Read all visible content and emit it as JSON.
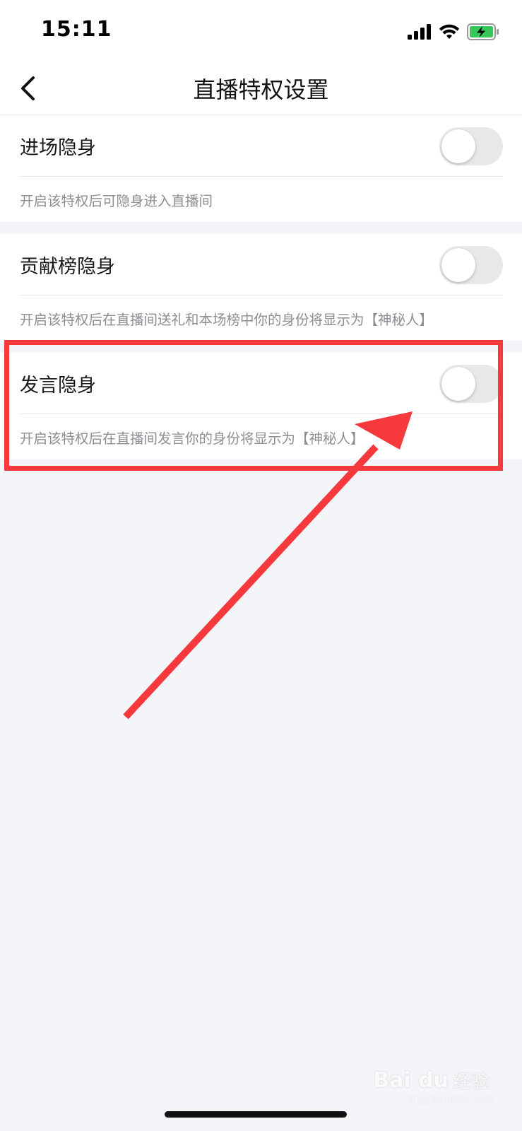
{
  "status_bar": {
    "time": "15:11",
    "icons": [
      "cellular-signal-icon",
      "wifi-icon",
      "battery-charging-icon"
    ],
    "battery_color": "#34c759"
  },
  "nav": {
    "title": "直播特权设置",
    "back_icon": "chevron-left-icon"
  },
  "settings": [
    {
      "title": "进场隐身",
      "description": "开启该特权后可隐身进入直播间",
      "enabled": false
    },
    {
      "title": "贡献榜隐身",
      "description": "开启该特权后在直播间送礼和本场榜中你的身份将显示为【神秘人】",
      "enabled": false
    },
    {
      "title": "发言隐身",
      "description": "开启该特权后在直播间发言你的身份将显示为【神秘人】",
      "enabled": false
    }
  ],
  "annotation": {
    "color": "#f5393c"
  },
  "watermark": {
    "brand": "Bai du",
    "label": "经验",
    "url": "jingyan.baidu.com"
  }
}
